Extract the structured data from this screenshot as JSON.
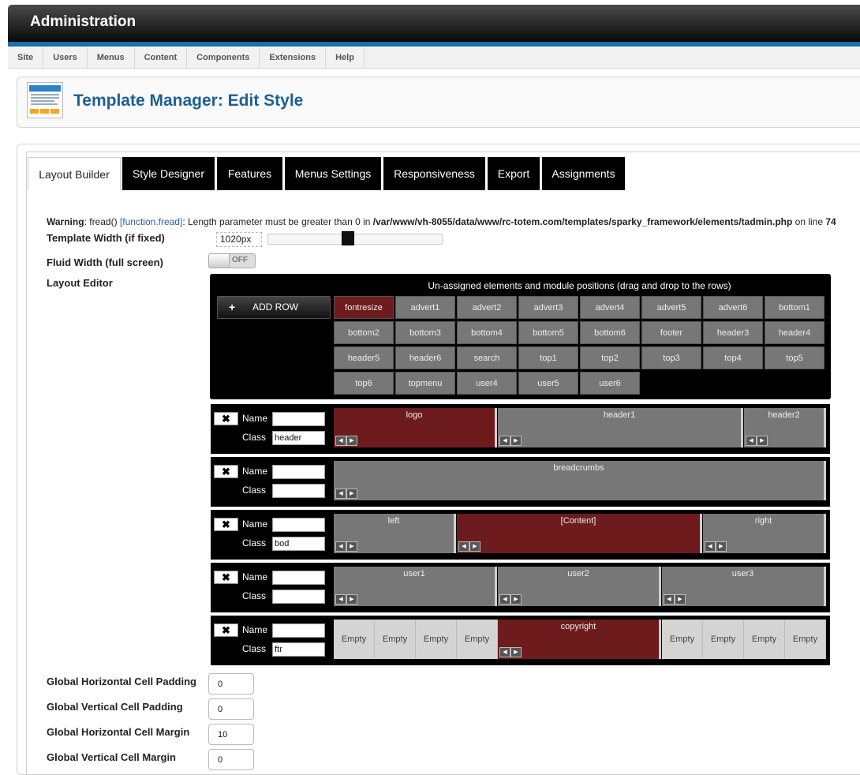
{
  "app_title": "Administration",
  "menu": [
    "Site",
    "Users",
    "Menus",
    "Content",
    "Components",
    "Extensions",
    "Help"
  ],
  "page_title": "Template Manager: Edit Style",
  "tabs": [
    "Layout Builder",
    "Style Designer",
    "Features",
    "Menus Settings",
    "Responsiveness",
    "Export",
    "Assignments"
  ],
  "warning": {
    "label": "Warning",
    "func": ": fread() ",
    "link": "[function.fread]",
    "msg": ": Length parameter must be greater than 0 in ",
    "path": "/var/www/vh-8055/data/www/rc-totem.com/templates/sparky_framework/elements/tadmin.php",
    "online": " on line ",
    "line": "74"
  },
  "template_width": {
    "label": "Template Width (if fixed)",
    "value": "1020px"
  },
  "fluid_width": {
    "label": "Fluid Width (full screen)",
    "toggle_text": "OFF"
  },
  "layout_editor": {
    "label": "Layout Editor",
    "unassigned_heading": "Un-assigned elements and module positions (drag and drop to the rows)",
    "add_row": "ADD ROW",
    "chips": [
      "fontresize",
      "advert1",
      "advert2",
      "advert3",
      "advert4",
      "advert5",
      "advert6",
      "bottom1",
      "bottom2",
      "bottom3",
      "bottom4",
      "bottom5",
      "bottom6",
      "footer",
      "header3",
      "header4",
      "header5",
      "header6",
      "search",
      "top1",
      "top2",
      "top3",
      "top4",
      "top5",
      "top6",
      "topmenu",
      "user4",
      "user5",
      "user6"
    ]
  },
  "row_labels": {
    "name": "Name",
    "class": "Class"
  },
  "rows": [
    {
      "class_value": "header",
      "cells": [
        {
          "label": "logo",
          "kind": "red"
        },
        {
          "label": "header1",
          "kind": "gray"
        },
        {
          "label": "header2",
          "kind": "gray"
        }
      ]
    },
    {
      "class_value": "",
      "cells": [
        {
          "label": "breadcrumbs",
          "kind": "gray"
        }
      ]
    },
    {
      "class_value": "bod",
      "cells": [
        {
          "label": "left",
          "kind": "gray"
        },
        {
          "label": "[Content]",
          "kind": "red"
        },
        {
          "label": "right",
          "kind": "gray"
        }
      ]
    },
    {
      "class_value": "",
      "cells": [
        {
          "label": "user1",
          "kind": "gray"
        },
        {
          "label": "user2",
          "kind": "gray"
        },
        {
          "label": "user3",
          "kind": "gray"
        }
      ]
    },
    {
      "class_value": "ftr",
      "cells": [
        {
          "label": "Empty",
          "kind": "empty"
        },
        {
          "label": "Empty",
          "kind": "empty"
        },
        {
          "label": "Empty",
          "kind": "empty"
        },
        {
          "label": "Empty",
          "kind": "empty"
        },
        {
          "label": "copyright",
          "kind": "red"
        },
        {
          "label": "Empty",
          "kind": "empty"
        },
        {
          "label": "Empty",
          "kind": "empty"
        },
        {
          "label": "Empty",
          "kind": "empty"
        },
        {
          "label": "Empty",
          "kind": "empty"
        }
      ]
    }
  ],
  "global_settings": [
    {
      "label": "Global Horizontal Cell Padding",
      "value": "0"
    },
    {
      "label": "Global Vertical Cell Padding",
      "value": "0"
    },
    {
      "label": "Global Horizontal Cell Margin",
      "value": "10"
    },
    {
      "label": "Global Vertical Cell Margin",
      "value": "0"
    }
  ],
  "colors": {
    "brand_blue": "#1a6fae",
    "title_blue": "#1d5f96",
    "assigned_red": "#6d1b1d",
    "cell_gray": "#777777"
  },
  "icons": {
    "add_row": "plus-icon",
    "remove_row": "close-x-icon",
    "cell_shrink": "arrow-left-icon",
    "cell_grow": "arrow-right-icon"
  }
}
